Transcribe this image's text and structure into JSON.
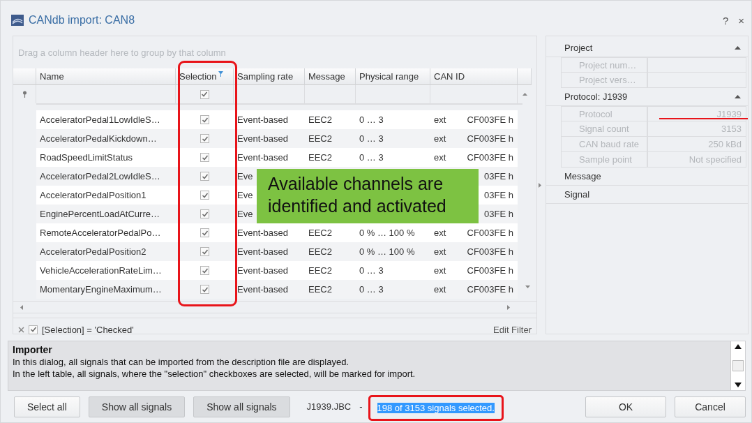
{
  "window": {
    "title": "CANdb import: CAN8",
    "help_button": "?",
    "close_button": "×"
  },
  "grid": {
    "group_hint": "Drag a column header here to group by that column",
    "columns": [
      {
        "label": "Name",
        "filtered": false
      },
      {
        "label": "Selection",
        "filtered": true
      },
      {
        "label": "Sampling rate",
        "filtered": false
      },
      {
        "label": "Message",
        "filtered": false
      },
      {
        "label": "Physical range",
        "filtered": false
      },
      {
        "label": "CAN ID",
        "filtered": false
      }
    ],
    "filter_row": {
      "checked": true
    },
    "rows": [
      {
        "name": "AcceleratorPedal1LowIdleS…",
        "checked": true,
        "sampling_rate": "Event-based",
        "message": "EEC2",
        "physical_range": "0 … 3",
        "can_id_type": "ext",
        "can_id": "CF003FE h"
      },
      {
        "name": "AcceleratorPedalKickdown…",
        "checked": true,
        "sampling_rate": "Event-based",
        "message": "EEC2",
        "physical_range": "0 … 3",
        "can_id_type": "ext",
        "can_id": "CF003FE h"
      },
      {
        "name": "RoadSpeedLimitStatus",
        "checked": true,
        "sampling_rate": "Event-based",
        "message": "EEC2",
        "physical_range": "0 … 3",
        "can_id_type": "ext",
        "can_id": "CF003FE h"
      },
      {
        "name": "AcceleratorPedal2LowIdleS…",
        "checked": true,
        "sampling_rate": "Eve",
        "can_id": "03FE h"
      },
      {
        "name": "AcceleratorPedalPosition1",
        "checked": true,
        "sampling_rate": "Eve",
        "can_id": "03FE h"
      },
      {
        "name": "EnginePercentLoadAtCurre…",
        "checked": true,
        "sampling_rate": "Eve",
        "can_id": "03FE h"
      },
      {
        "name": "RemoteAcceleratorPedalPo…",
        "checked": true,
        "sampling_rate": "Event-based",
        "message": "EEC2",
        "physical_range": "0 % … 100 %",
        "can_id_type": "ext",
        "can_id": "CF003FE h"
      },
      {
        "name": "AcceleratorPedalPosition2",
        "checked": true,
        "sampling_rate": "Event-based",
        "message": "EEC2",
        "physical_range": "0 % … 100 %",
        "can_id_type": "ext",
        "can_id": "CF003FE h"
      },
      {
        "name": "VehicleAccelerationRateLim…",
        "checked": true,
        "sampling_rate": "Event-based",
        "message": "EEC2",
        "physical_range": "0 … 3",
        "can_id_type": "ext",
        "can_id": "CF003FE h"
      },
      {
        "name": "MomentaryEngineMaximum…",
        "checked": true,
        "sampling_rate": "Event-based",
        "message": "EEC2",
        "physical_range": "0 … 3",
        "can_id_type": "ext",
        "can_id": "CF003FE h"
      }
    ],
    "filter": {
      "checked": true,
      "text": "[Selection] = 'Checked'",
      "edit_label": "Edit Filter"
    }
  },
  "callout": {
    "text": "Available channels are identified and activated"
  },
  "properties": {
    "sections": [
      {
        "title": "Project",
        "expanded": true,
        "rows": [
          {
            "label": "Project num…"
          },
          {
            "label": "Project vers…"
          }
        ]
      },
      {
        "title": "Protocol: J1939",
        "expanded": true,
        "rows": [
          {
            "label": "Protocol",
            "value": "J1939"
          },
          {
            "label": "Signal count",
            "value": "3153"
          },
          {
            "label": "CAN baud rate",
            "value": "250 kBd"
          },
          {
            "label": "Sample point",
            "value": "Not specified"
          }
        ]
      },
      {
        "title": "Message",
        "expanded": false
      },
      {
        "title": "Signal",
        "expanded": false
      }
    ]
  },
  "help": {
    "title": "Importer",
    "lines": [
      "In this dialog, all signals that can be imported from the description file are displayed.",
      "In the left table, all signals, where the \"selection\" checkboxes are selected, will be marked for import."
    ]
  },
  "footer": {
    "buttons": [
      "Select all",
      "Show all signals",
      "Show all signals"
    ],
    "file": "J1939.JBC",
    "separator": "-",
    "status": "198 of 3153 signals selected.",
    "ok": "OK",
    "cancel": "Cancel"
  }
}
